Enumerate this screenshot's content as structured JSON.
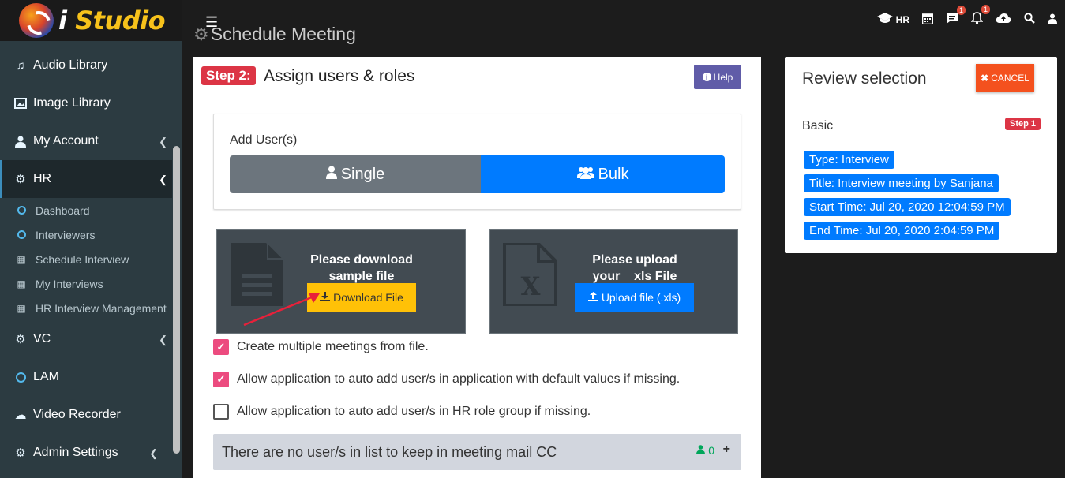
{
  "brand": {
    "prefix": "i",
    "name": "Studio"
  },
  "sidebar": {
    "items": [
      {
        "key": "audio",
        "label": "Audio Library",
        "icon": "music-icon"
      },
      {
        "key": "image",
        "label": "Image Library",
        "icon": "image-icon"
      },
      {
        "key": "account",
        "label": "My Account",
        "icon": "user-icon"
      },
      {
        "key": "hr",
        "label": "HR",
        "icon": "cogs-icon"
      },
      {
        "key": "vc",
        "label": "VC",
        "icon": "cogs-icon"
      },
      {
        "key": "lam",
        "label": "LAM",
        "icon": "circle-icon"
      },
      {
        "key": "video",
        "label": "Video Recorder",
        "icon": "cloud-upload-icon"
      },
      {
        "key": "admin",
        "label": "Admin Settings",
        "icon": "cogs-icon"
      }
    ],
    "hr_sub": [
      {
        "label": "Dashboard",
        "icon": "circle-icon"
      },
      {
        "label": "Interviewers",
        "icon": "circle-icon"
      },
      {
        "label": "Schedule Interview",
        "icon": "calendar-icon"
      },
      {
        "label": "My Interviews",
        "icon": "calendar-icon"
      },
      {
        "label": "HR Interview Management",
        "icon": "calendar-icon"
      }
    ]
  },
  "topbar": {
    "page_title": "Schedule Meeting",
    "role_label": "HR",
    "messages_badge": "1",
    "notifications_badge": "1"
  },
  "step": {
    "label": "Step 2:",
    "title": "Assign users & roles",
    "help_label": "Help"
  },
  "add_users": {
    "label": "Add User(s)",
    "single_label": "Single",
    "bulk_label": "Bulk"
  },
  "download_tile": {
    "line1": "Please download",
    "line2": "sample file",
    "button": "Download File"
  },
  "upload_tile": {
    "line1": "Please upload",
    "line2": "your    xls File",
    "button": "Upload file (.xls)"
  },
  "options": [
    {
      "label": "Create multiple meetings from file.",
      "checked": true
    },
    {
      "label": "Allow application to auto add user/s in application with default values if missing.",
      "checked": true
    },
    {
      "label": "Allow application to auto add user/s in HR role group if missing.",
      "checked": false
    }
  ],
  "cc": {
    "text": "There are no user/s in list to keep in meeting mail CC",
    "count": "0"
  },
  "review": {
    "title": "Review selection",
    "cancel_label": "CANCEL",
    "basic_label": "Basic",
    "step_badge": "Step 1",
    "pills": [
      "Type: Interview",
      "Title: Interview meeting by Sanjana",
      "Start Time: Jul 20, 2020 12:04:59 PM",
      "End Time: Jul 20, 2020 2:04:59 PM"
    ]
  },
  "colors": {
    "primary": "#007bff",
    "danger": "#dc3545",
    "warning": "#ffc107",
    "check": "#ec4b7f",
    "cancel": "#f4511e",
    "help": "#605ca8"
  }
}
